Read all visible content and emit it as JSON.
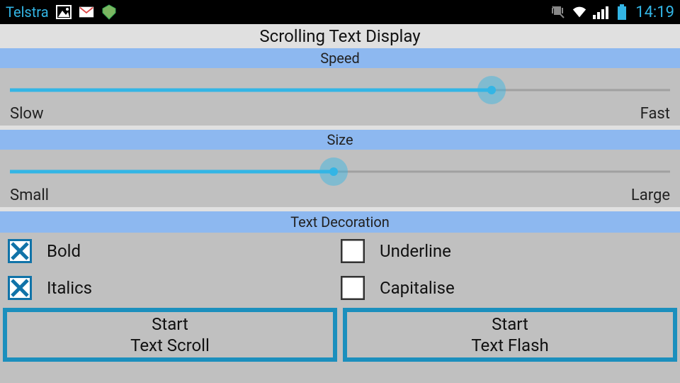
{
  "statusBar": {
    "carrier": "Telstra",
    "time": "14:19"
  },
  "title": "Scrolling Text Display",
  "speed": {
    "header": "Speed",
    "leftLabel": "Slow",
    "rightLabel": "Fast",
    "valuePercent": 73
  },
  "size": {
    "header": "Size",
    "leftLabel": "Small",
    "rightLabel": "Large",
    "valuePercent": 49
  },
  "decoration": {
    "header": "Text Decoration",
    "options": {
      "bold": {
        "label": "Bold",
        "checked": true
      },
      "underline": {
        "label": "Underline",
        "checked": false
      },
      "italics": {
        "label": "Italics",
        "checked": true
      },
      "capitalise": {
        "label": "Capitalise",
        "checked": false
      }
    }
  },
  "buttons": {
    "scroll": {
      "line1": "Start",
      "line2": "Text Scroll"
    },
    "flash": {
      "line1": "Start",
      "line2": "Text Flash"
    }
  },
  "colors": {
    "accent": "#33b5e5",
    "sectionHeader": "#8db8f0",
    "buttonBorder": "#1b8fbd"
  }
}
